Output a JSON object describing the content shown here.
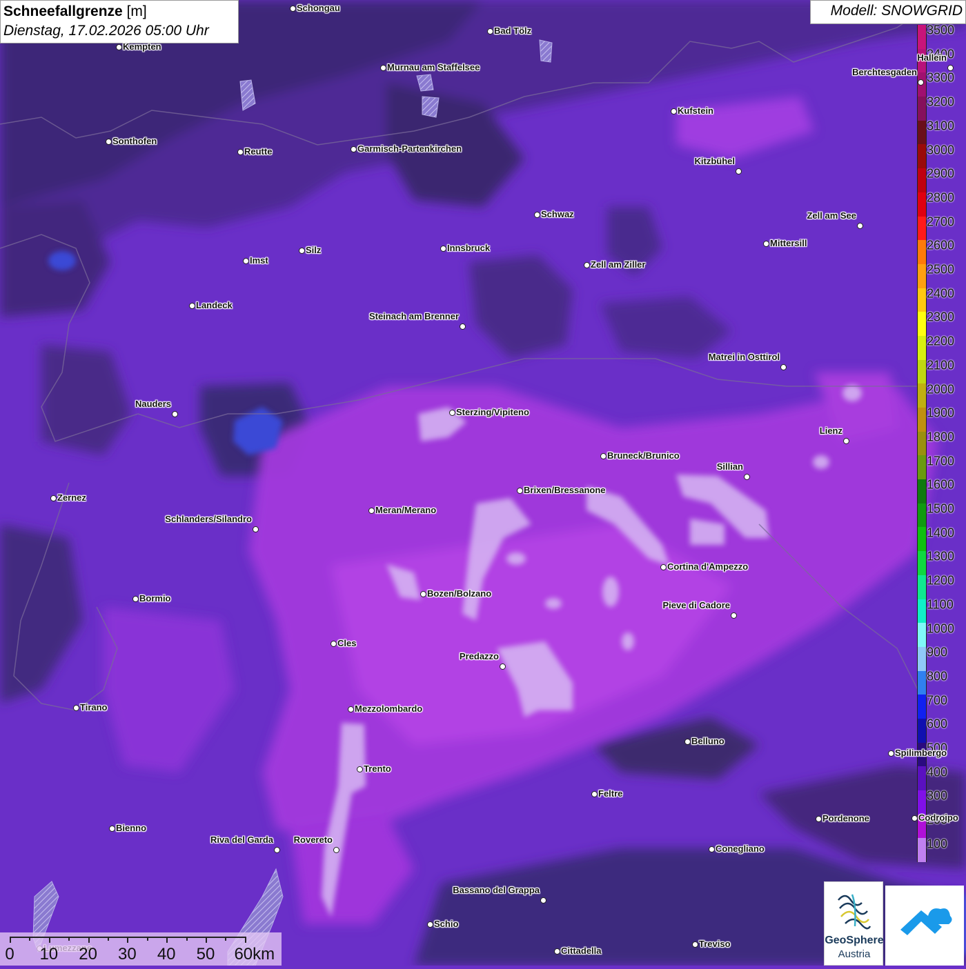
{
  "title": {
    "bold": "Schneefallgrenze",
    "unit": " [m]",
    "datetime": "Dienstag, 17.02.2026 05:00 Uhr"
  },
  "model": "Modell: SNOWGRID",
  "colors": {
    "background_typical": "#6a2fc8",
    "dark_zone": "#3d2a7a",
    "pink_zone": "#b03adf",
    "light_zone": "#d9b6f0",
    "blue_zone": "#3a4ad8"
  },
  "legend": [
    {
      "label": "3500",
      "color": "#c8147a"
    },
    {
      "label": "3400",
      "color": "#b8127a"
    },
    {
      "label": "3300",
      "color": "#a01070"
    },
    {
      "label": "3200",
      "color": "#86105c"
    },
    {
      "label": "3100",
      "color": "#6a0f1a"
    },
    {
      "label": "3000",
      "color": "#9a0a0a"
    },
    {
      "label": "2900",
      "color": "#c00010"
    },
    {
      "label": "2800",
      "color": "#e00010"
    },
    {
      "label": "2700",
      "color": "#ff1a1a"
    },
    {
      "label": "2600",
      "color": "#ff7a0a"
    },
    {
      "label": "2500",
      "color": "#ffa010"
    },
    {
      "label": "2400",
      "color": "#ffc810"
    },
    {
      "label": "2300",
      "color": "#ffff10"
    },
    {
      "label": "2200",
      "color": "#d8f010"
    },
    {
      "label": "2100",
      "color": "#c0d810"
    },
    {
      "label": "2000",
      "color": "#c0b010"
    },
    {
      "label": "1900",
      "color": "#c09010"
    },
    {
      "label": "1800",
      "color": "#9a9010"
    },
    {
      "label": "1700",
      "color": "#6a9a10"
    },
    {
      "label": "1600",
      "color": "#107a10"
    },
    {
      "label": "1500",
      "color": "#109a10"
    },
    {
      "label": "1400",
      "color": "#10c010"
    },
    {
      "label": "1300",
      "color": "#10d840"
    },
    {
      "label": "1200",
      "color": "#10e890"
    },
    {
      "label": "1100",
      "color": "#10f0c8"
    },
    {
      "label": "1000",
      "color": "#80f8f8"
    },
    {
      "label": "900",
      "color": "#90c8f8"
    },
    {
      "label": "800",
      "color": "#3080f0"
    },
    {
      "label": "700",
      "color": "#1020f0"
    },
    {
      "label": "600",
      "color": "#1010b0"
    },
    {
      "label": "500",
      "color": "#2a0a80"
    },
    {
      "label": "400",
      "color": "#5a10c0"
    },
    {
      "label": "300",
      "color": "#8010e8"
    },
    {
      "label": "200",
      "color": "#b010d8"
    },
    {
      "label": "100",
      "color": "#c080f0"
    }
  ],
  "cities": [
    {
      "name": "Schongau",
      "side": "r"
    },
    {
      "name": "Bad Tölz",
      "side": "r"
    },
    {
      "name": "Kempten",
      "side": "r"
    },
    {
      "name": "Murnau am Staffelsee",
      "side": "r"
    },
    {
      "name": "Hallein",
      "side": "l"
    },
    {
      "name": "Berchtesgaden",
      "side": "l"
    },
    {
      "name": "Kufstein",
      "side": "r"
    },
    {
      "name": "Sonthofen",
      "side": "r"
    },
    {
      "name": "Reutte",
      "side": "r"
    },
    {
      "name": "Garmisch-Partenkirchen",
      "side": "r"
    },
    {
      "name": "Kitzbühel",
      "side": "l"
    },
    {
      "name": "Schwaz",
      "side": "r"
    },
    {
      "name": "Zell am See",
      "side": "l"
    },
    {
      "name": "Innsbruck",
      "side": "r"
    },
    {
      "name": "Mittersill",
      "side": "r"
    },
    {
      "name": "Silz",
      "side": "r"
    },
    {
      "name": "Imst",
      "side": "r"
    },
    {
      "name": "Zell am Ziller",
      "side": "r"
    },
    {
      "name": "Landeck",
      "side": "r"
    },
    {
      "name": "Steinach am Brenner",
      "side": "l"
    },
    {
      "name": "Matrei in Osttirol",
      "side": "l"
    },
    {
      "name": "Nauders",
      "side": "l"
    },
    {
      "name": "Sterzing/Vipiteno",
      "side": "r"
    },
    {
      "name": "Lienz",
      "side": "l"
    },
    {
      "name": "Bruneck/Brunico",
      "side": "r"
    },
    {
      "name": "Sillian",
      "side": "l"
    },
    {
      "name": "Zernez",
      "side": "r"
    },
    {
      "name": "Brixen/Bressanone",
      "side": "r"
    },
    {
      "name": "Meran/Merano",
      "side": "r"
    },
    {
      "name": "Schlanders/Silandro",
      "side": "l"
    },
    {
      "name": "Cortina d'Ampezzo",
      "side": "r"
    },
    {
      "name": "Bozen/Bolzano",
      "side": "r"
    },
    {
      "name": "Bormio",
      "side": "r"
    },
    {
      "name": "Pieve di Cadore",
      "side": "l"
    },
    {
      "name": "Cles",
      "side": "r"
    },
    {
      "name": "Predazzo",
      "side": "l"
    },
    {
      "name": "Tirano",
      "side": "r"
    },
    {
      "name": "Mezzolombardo",
      "side": "r"
    },
    {
      "name": "Belluno",
      "side": "r"
    },
    {
      "name": "Spilimbergo",
      "side": "r"
    },
    {
      "name": "Trento",
      "side": "r"
    },
    {
      "name": "Feltre",
      "side": "r"
    },
    {
      "name": "Pordenone",
      "side": "r"
    },
    {
      "name": "Codroipo",
      "side": "r"
    },
    {
      "name": "Bienno",
      "side": "r"
    },
    {
      "name": "Riva del Garda",
      "side": "l"
    },
    {
      "name": "Rovereto",
      "side": "l"
    },
    {
      "name": "Conegliano",
      "side": "r"
    },
    {
      "name": "Bassano del Grappa",
      "side": "l"
    },
    {
      "name": "Schio",
      "side": "r"
    },
    {
      "name": "Lumezzane",
      "side": "r"
    },
    {
      "name": "Treviso",
      "side": "r"
    },
    {
      "name": "Cittadella",
      "side": "r"
    }
  ],
  "scale": {
    "labels": [
      "0",
      "10",
      "20",
      "30",
      "40",
      "50",
      "60km"
    ]
  },
  "logos": {
    "geosphere_line1": "GeoSphere",
    "geosphere_line2": "Austria"
  }
}
